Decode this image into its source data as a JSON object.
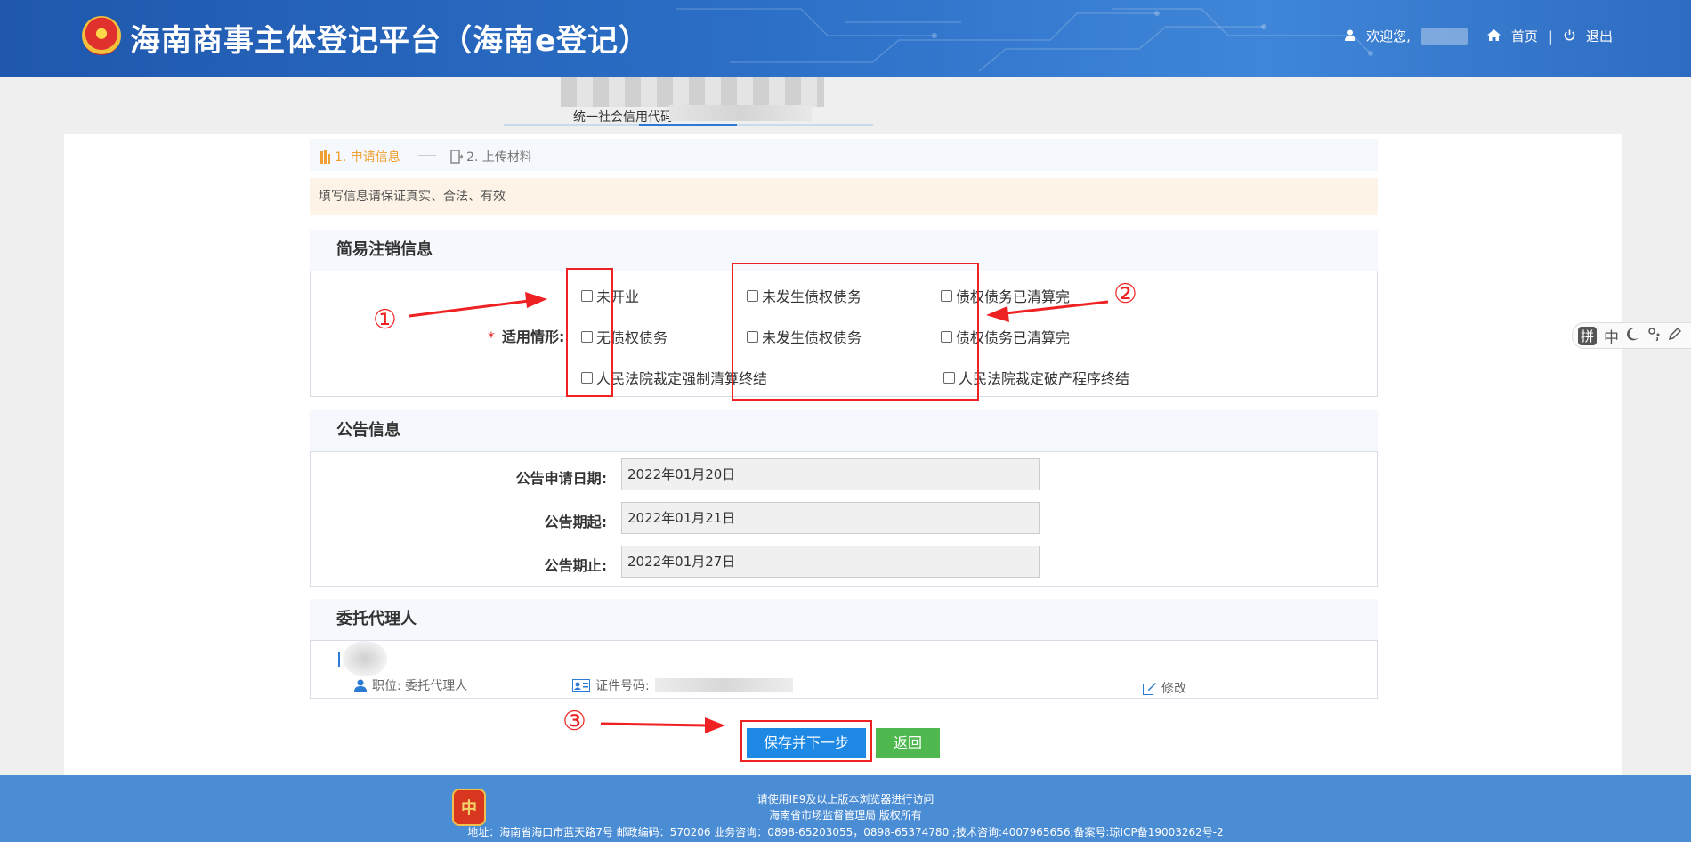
{
  "header": {
    "title": "海南商事主体登记平台（海南e登记）",
    "welcome": "欢迎您,",
    "home": "首页",
    "separator": "|",
    "logout": "退出"
  },
  "company": {
    "credit_label": "统一社会信用代码:"
  },
  "steps": {
    "step1": "1. 申请信息",
    "step2": "2. 上传材料"
  },
  "notice": "填写信息请保证真实、合法、有效",
  "simple_cancel": {
    "title": "简易注销信息",
    "label": "适用情形:",
    "required": "*",
    "options": [
      "未开业",
      "未发生债权债务",
      "债权债务已清算完",
      "无债权债务",
      "未发生债权债务",
      "债权债务已清算完",
      "人民法院裁定强制清算终结",
      "人民法院裁定破产程序终结"
    ]
  },
  "announcement": {
    "title": "公告信息",
    "apply_date_label": "公告申请日期:",
    "apply_date": "2022年01月20日",
    "start_label": "公告期起:",
    "start": "2022年01月21日",
    "end_label": "公告期止:",
    "end": "2022年01月27日"
  },
  "agent": {
    "title": "委托代理人",
    "position": "职位:  委托代理人",
    "id_label": "证件号码:",
    "edit": "修改"
  },
  "buttons": {
    "save_next": "保存并下一步",
    "back": "返回"
  },
  "annotations": [
    "①",
    "②",
    "③"
  ],
  "footer": {
    "line1": "请使用IE9及以上版本浏览器进行访问",
    "line2": "海南省市场监督管理局 版权所有",
    "line3": "地址：海南省海口市蓝天路7号 邮政编码：570206 业务咨询：0898-65203055，0898-65374780 ;技术咨询:4007965656;备案号:琼ICP备19003262号-2"
  },
  "ime": {
    "pinyin": "拼",
    "zh": "中"
  },
  "colors": {
    "header": "#2c6fc7",
    "primary": "#1e88e5",
    "back": "#4fb84f",
    "annotation": "#e22222",
    "step_active": "#f0a030",
    "footer": "#4b8dd4"
  }
}
